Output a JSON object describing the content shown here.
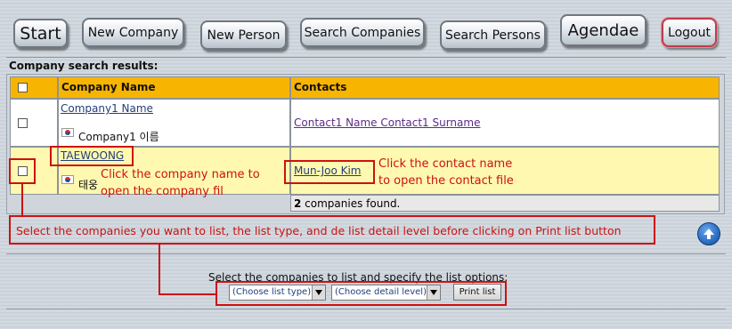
{
  "toolbar": {
    "start": "Start",
    "new_company": "New Company",
    "new_person": "New Person",
    "search_companies": "Search Companies",
    "search_persons": "Search Persons",
    "agendae": "Agendae",
    "logout": "Logout"
  },
  "results": {
    "title": "Company search results:",
    "columns": {
      "company": "Company Name",
      "contacts": "Contacts"
    },
    "rows": [
      {
        "company": "Company1 Name",
        "local_name": "Company1 이름",
        "contact": "Contact1 Name Contact1 Surname"
      },
      {
        "company": "TAEWOONG",
        "local_name": "태웅",
        "contact": "Mun-Joo Kim"
      }
    ],
    "count": "2",
    "count_text": " companies found."
  },
  "annotations": {
    "company_hint_1": "Click the company name to",
    "company_hint_2": "open the company fil",
    "contact_hint_1": "Click the contact name",
    "contact_hint_2": "to open the contact file",
    "select_hint": "Select the companies you want to list, the list type, and de list detail level before clicking on Print list button"
  },
  "options": {
    "label": "Select the companies to list and specify the list options:",
    "list_type": "(Choose list type)",
    "detail_level": "(Choose detail level)",
    "print": "Print list"
  },
  "colors": {
    "header": "#f7b400",
    "highlight_row": "#fff8b0",
    "annotation": "#cc1111"
  }
}
